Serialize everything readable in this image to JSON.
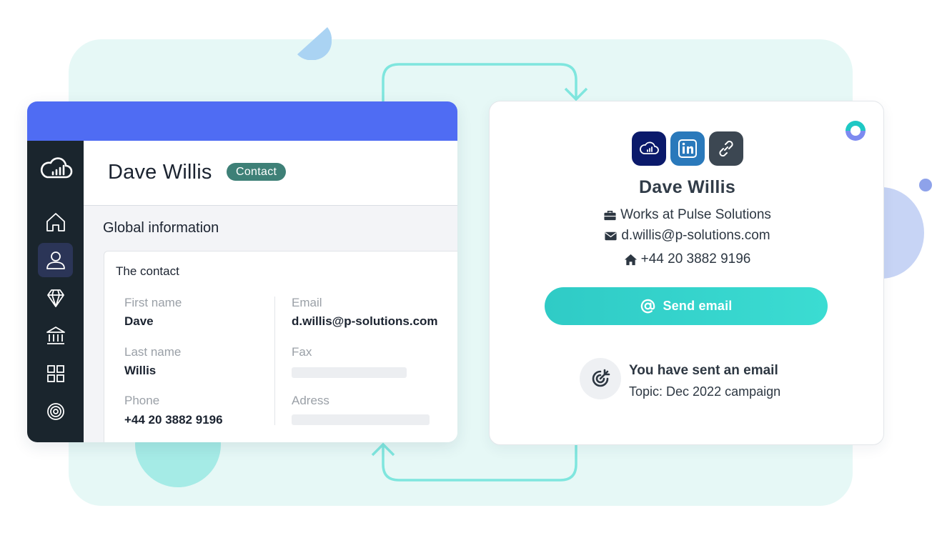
{
  "crm": {
    "contact_name": "Dave Willis",
    "badge": "Contact",
    "section_title": "Global information",
    "card_title": "The contact",
    "fields": {
      "first_name_label": "First name",
      "first_name_value": "Dave",
      "last_name_label": "Last name",
      "last_name_value": "Willis",
      "phone_label": "Phone",
      "phone_value": "+44 20 3882 9196",
      "email_label": "Email",
      "email_value": "d.willis@p-solutions.com",
      "fax_label": "Fax",
      "address_label": "Adress"
    },
    "sidebar_icons": [
      "cloud-analytics-icon",
      "home-icon",
      "user-icon",
      "diamond-icon",
      "bank-icon",
      "grid-icon",
      "target-icon"
    ],
    "colors": {
      "titlebar": "#4f6cf3",
      "sidebar": "#1a252d",
      "badge": "#3e8077"
    }
  },
  "profile": {
    "name": "Dave Willis",
    "company": "Works at Pulse Solutions",
    "email": "d.willis@p-solutions.com",
    "phone": "+44 20 3882 9196",
    "send_button": "Send email",
    "activity_title": "You have sent an email",
    "activity_topic": "Topic: Dec 2022 campaign",
    "social_icons": [
      "cloud-analytics-icon",
      "linkedin-icon",
      "link-icon"
    ],
    "colors": {
      "button": "#36d3cc",
      "text": "#2d3742"
    }
  }
}
